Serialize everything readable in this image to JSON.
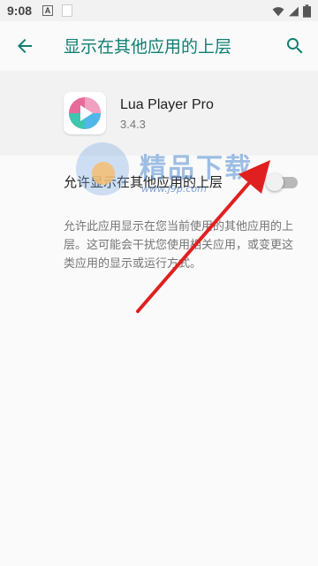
{
  "status_bar": {
    "time": "9:08",
    "a_badge": "A"
  },
  "app_bar": {
    "title": "显示在其他应用的上层"
  },
  "app": {
    "name": "Lua Player Pro",
    "version": "3.4.3"
  },
  "setting": {
    "label": "允许显示在其他应用的上层",
    "enabled": false
  },
  "description": "允许此应用显示在您当前使用的其他应用的上层。这可能会干扰您使用相关应用，或变更这类应用的显示或运行方式。",
  "watermark": {
    "title": "精品下载",
    "url": "www.j9p.com"
  },
  "colors": {
    "accent": "#117e72",
    "arrow": "#e02020"
  }
}
